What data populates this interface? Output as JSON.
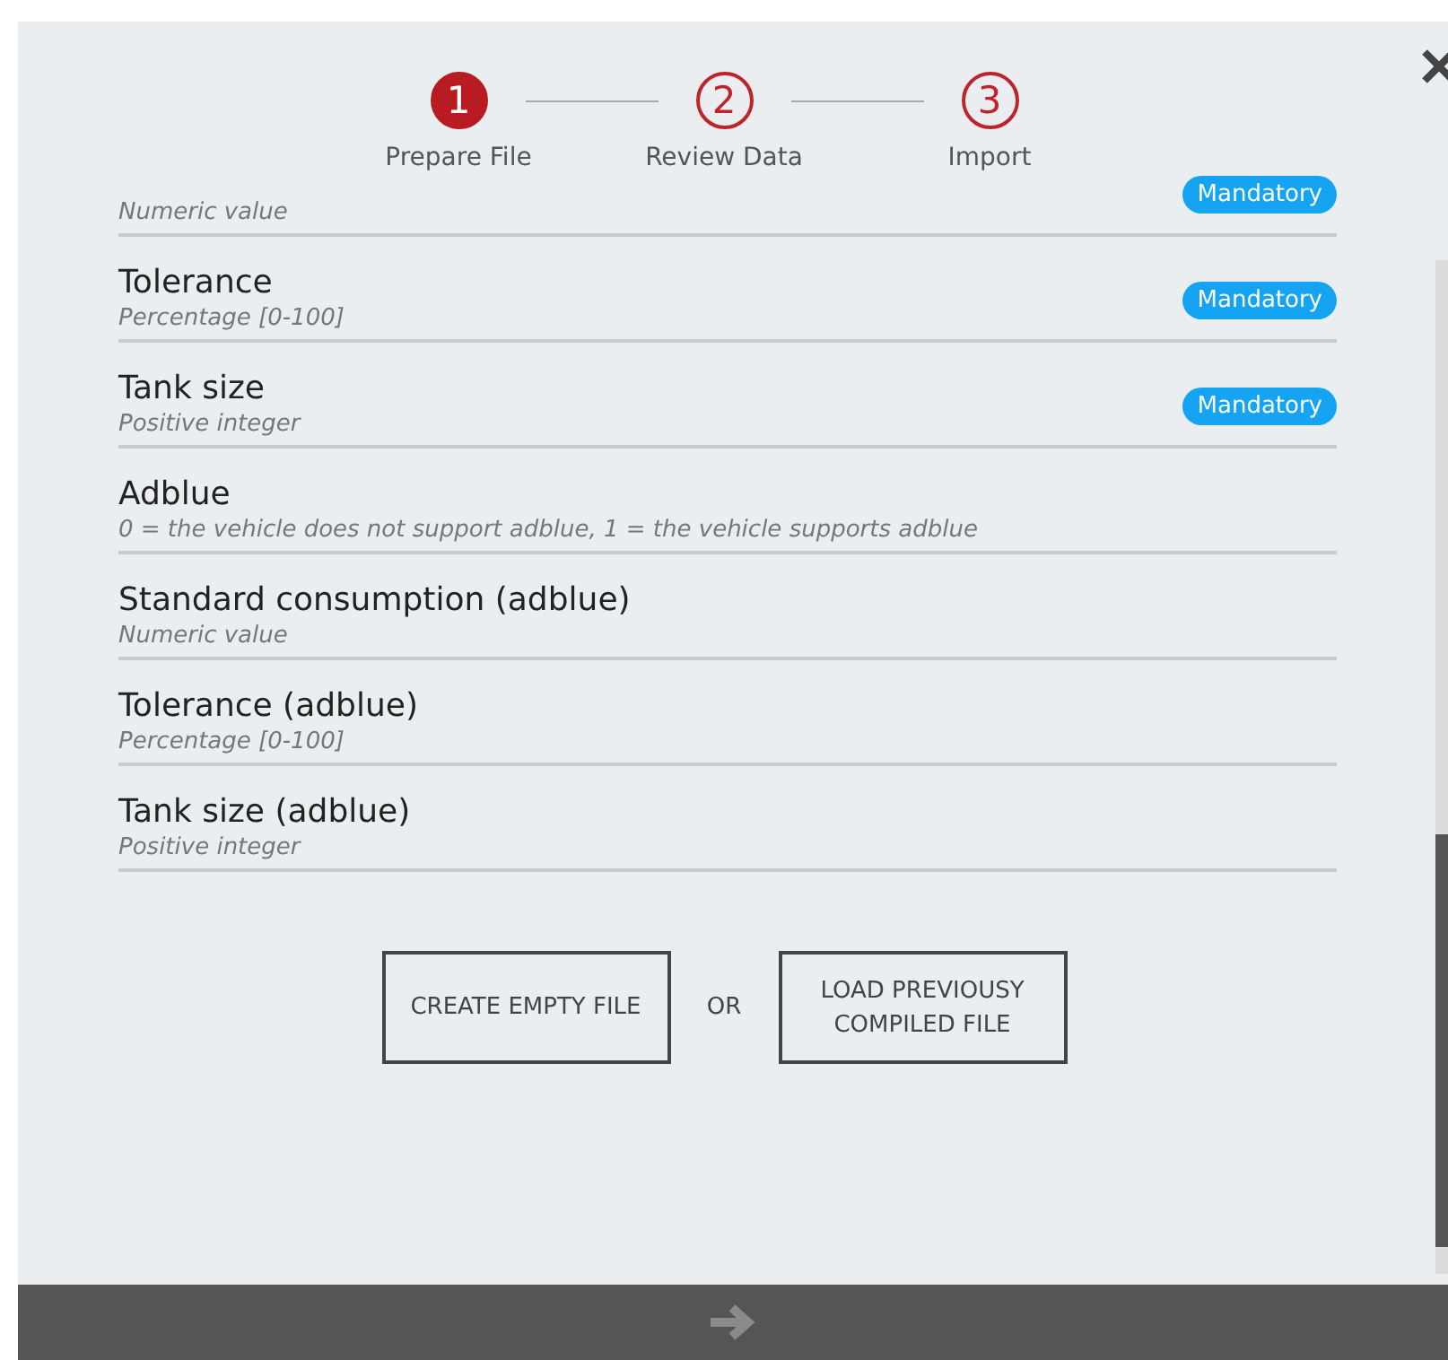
{
  "steps": [
    {
      "number": "1",
      "label": "Prepare File",
      "selected": true
    },
    {
      "number": "2",
      "label": "Review Data",
      "selected": false
    },
    {
      "number": "3",
      "label": "Import",
      "selected": false
    }
  ],
  "fields": [
    {
      "description": "Numeric value",
      "badge": "Mandatory"
    },
    {
      "name": "Tolerance",
      "description": "Percentage [0-100]",
      "badge": "Mandatory"
    },
    {
      "name": "Tank size",
      "description": "Positive integer",
      "badge": "Mandatory"
    },
    {
      "name": "Adblue",
      "description": "0 = the vehicle does not support adblue, 1 = the vehicle supports adblue"
    },
    {
      "name": "Standard consumption (adblue)",
      "description": "Numeric value"
    },
    {
      "name": "Tolerance (adblue)",
      "description": "Percentage [0-100]"
    },
    {
      "name": "Tank size (adblue)",
      "description": "Positive integer"
    }
  ],
  "actions": {
    "create": "CREATE EMPTY FILE",
    "separator": "OR",
    "load": "LOAD PREVIOUSY COMPILED FILE"
  }
}
